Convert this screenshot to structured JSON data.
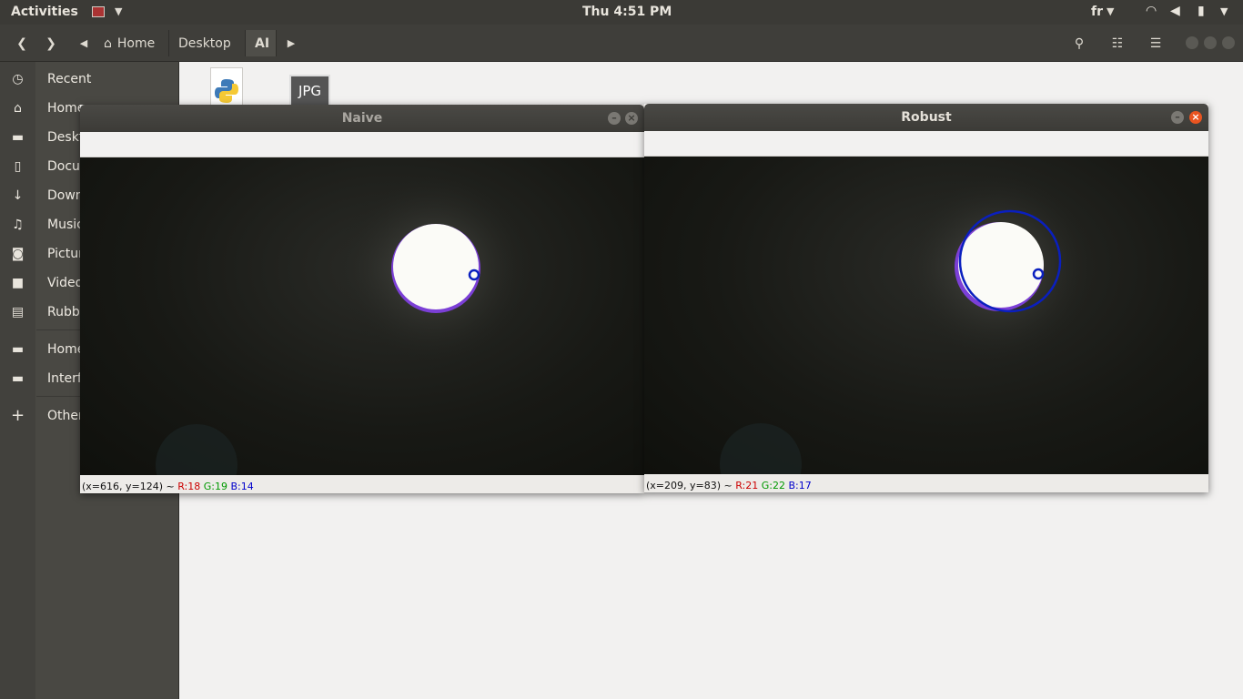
{
  "topbar": {
    "activities": "Activities",
    "clock": "Thu  4:51 PM",
    "lang": "fr"
  },
  "header": {
    "crumbs": [
      "Home",
      "Desktop",
      "AI"
    ]
  },
  "sidebar": {
    "items": [
      {
        "label": "Recent",
        "icon": "clock-icon"
      },
      {
        "label": "Home",
        "icon": "home-icon"
      },
      {
        "label": "Desktop",
        "icon": "folder-icon"
      },
      {
        "label": "Documents",
        "icon": "document-icon"
      },
      {
        "label": "Downloads",
        "icon": "download-icon"
      },
      {
        "label": "Music",
        "icon": "music-icon"
      },
      {
        "label": "Pictures",
        "icon": "camera-icon"
      },
      {
        "label": "Videos",
        "icon": "video-icon"
      },
      {
        "label": "Rubbish Bin",
        "icon": "trash-icon"
      },
      {
        "label": "Home",
        "icon": "folder-icon"
      },
      {
        "label": "Interface",
        "icon": "folder-icon"
      },
      {
        "label": "Other Locations",
        "icon": "plus-icon"
      }
    ]
  },
  "files": {
    "jpg_label": "JPG"
  },
  "windows": {
    "naive": {
      "title": "Naive",
      "status_coords": "(x=616, y=124) ~ ",
      "r": "R:18",
      "g": "G:19",
      "b": "B:14"
    },
    "robust": {
      "title": "Robust",
      "status_coords": "(x=209, y=83) ~ ",
      "r": "R:21",
      "g": "G:22",
      "b": "B:17"
    }
  }
}
